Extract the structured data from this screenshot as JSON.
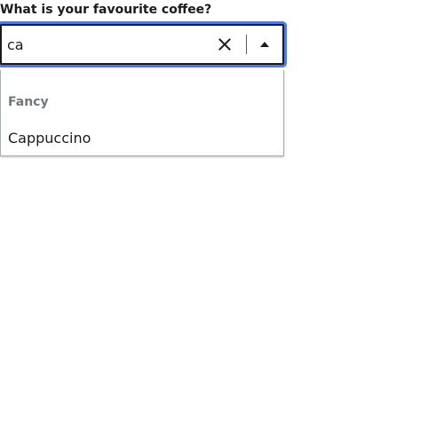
{
  "form": {
    "question_label": "What is your favourite coffee?"
  },
  "combobox": {
    "value": "ca",
    "clear_icon": "close-icon",
    "toggle_icon": "caret-up-icon",
    "focus_color": "#4f79e8"
  },
  "listbox": {
    "groups": [
      {
        "label": "Fancy",
        "options": [
          {
            "label": "Cappuccino"
          }
        ]
      }
    ]
  }
}
